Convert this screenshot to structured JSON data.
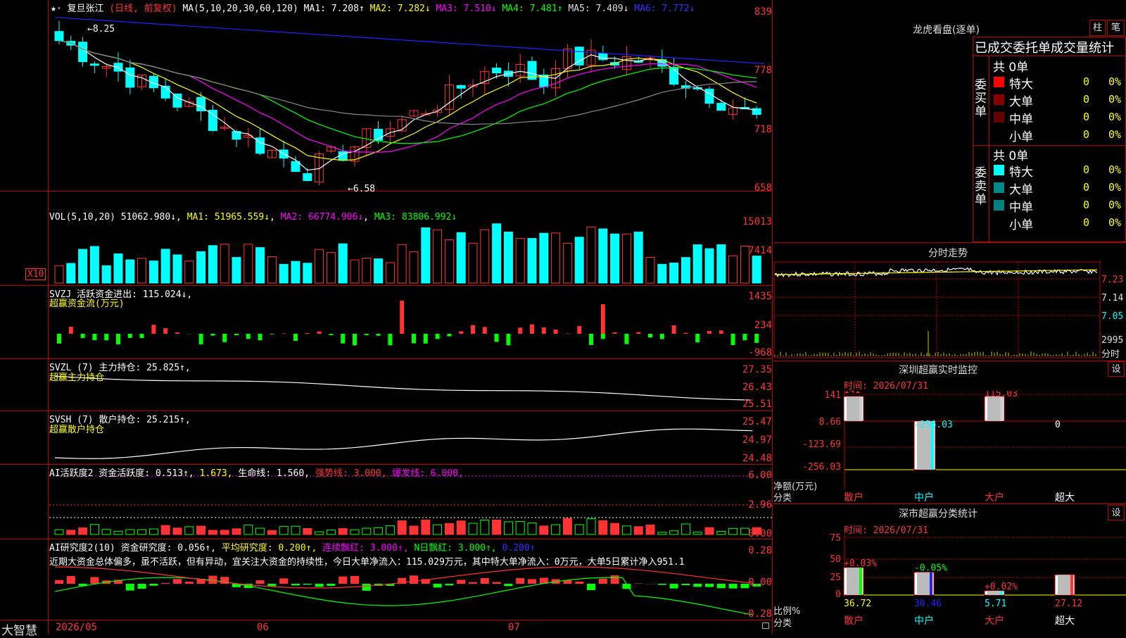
{
  "colors": {
    "up": "#ff3333",
    "down": "#00ffff",
    "ma1": "#ffffff",
    "ma2": "#ffff00",
    "ma3": "#ff00ff",
    "ma4": "#00ff00",
    "ma5": "#888888",
    "ma6": "#2222ff",
    "grid": "#aa0000",
    "axis": "#ff3333",
    "vol_up": "#ff3333",
    "green": "#00ff00",
    "yellow": "#ffff00"
  },
  "kline": {
    "stock_name": "复旦张江",
    "period": "(日线, 前复权)",
    "ma_title": "MA(5,10,20,30,60,120)",
    "ma1": "MA1: 7.208↑",
    "ma2": "MA2: 7.282↓",
    "ma3": "MA3: 7.510↓",
    "ma4": "MA4: 7.481↑",
    "ma5": "MA5: 7.409↓",
    "ma6": "MA6: 7.772↓",
    "high_mark": "8.25",
    "low_mark": "6.58",
    "y_ticks": [
      "839",
      "778",
      "718",
      "658"
    ]
  },
  "vol": {
    "title": "VOL(5,10,20)",
    "value": "51062.980↓",
    "ma1": "MA1: 51965.559↓",
    "ma2": "MA2: 66774.906↓",
    "ma3": "MA3: 83806.992↓",
    "y_ticks": [
      "15013",
      "7414"
    ],
    "unit": "X10"
  },
  "svzj": {
    "title": "SVZJ 活跃资金进出: 115.024↓,",
    "subtitle": "超赢资金流(万元)",
    "y_ticks": [
      "1435",
      "234",
      "-968"
    ]
  },
  "svzl": {
    "title": "SVZL (7) 主力持仓: 25.825↑,",
    "subtitle": "超赢主力持仓",
    "y_ticks": [
      "27.35",
      "26.43",
      "25.51"
    ]
  },
  "svsh": {
    "title": "SVSH (7) 散户持仓: 25.215↑,",
    "subtitle": "超赢散户持仓",
    "y_ticks": [
      "25.47",
      "24.97",
      "24.48"
    ]
  },
  "ai1": {
    "title": "AI活跃度2 资金活跃度: 0.513↑,",
    "v2": "1.673,",
    "life": "生命线: 1.560,",
    "strong": "强势线: 3.000,",
    "burst": "爆发线: 6.000,",
    "y_ticks": [
      "6.00",
      "2.96",
      "0.00"
    ]
  },
  "ai2": {
    "title": "AI研究度2(10) 资金研究度: 0.056↑,",
    "avg": "平均研究度: 0.200↑,",
    "red": "连续飘红: 3.000↑,",
    "nred": "N日飘红: 3.000↑,",
    "last": "0.200↑",
    "note": "近期大资金总体偏多，虽不活跃，但有异动，宜关注大资金的持续性，今日大单净流入：115.029万元，其中特大单净流入：0万元，大单5日累计净入951.1",
    "y_ticks": [
      "0.28",
      "0.00",
      "-0.28"
    ]
  },
  "bottom": {
    "brand": "大智慧",
    "dates": [
      "2026/05",
      "06",
      "07"
    ]
  },
  "dragon": {
    "title": "龙虎看盘(逐单)",
    "btn_zhu": "柱",
    "btn_bi": "笔",
    "subtitle": "已成交委托单成交量统计",
    "buy_label": "委买单",
    "sell_label": "委卖单",
    "buy_total": "共 0单",
    "sell_total": "共 0单",
    "buy_rows": [
      {
        "name": "特大",
        "count": "0",
        "pct": "0%"
      },
      {
        "name": "大单",
        "count": "0",
        "pct": "0%"
      },
      {
        "name": "中单",
        "count": "0",
        "pct": "0%"
      },
      {
        "name": "小单",
        "count": "0",
        "pct": "0%"
      }
    ],
    "sell_rows": [
      {
        "name": "特大",
        "count": "0",
        "pct": "0%"
      },
      {
        "name": "大单",
        "count": "0",
        "pct": "0%"
      },
      {
        "name": "中单",
        "count": "0",
        "pct": "0%"
      },
      {
        "name": "小单",
        "count": "0",
        "pct": "0%"
      }
    ]
  },
  "intraday": {
    "title": "分时走势",
    "y_ticks": [
      "7.23",
      "7.14",
      "7.05"
    ],
    "vol_tick": "2995",
    "vol_label": "分时"
  },
  "monitor": {
    "title": "深圳超赢实时监控",
    "btn": "设",
    "time": "时间: 2026/07/31",
    "y_ticks": [
      "141",
      "8.66",
      "-123.69",
      "-256.03"
    ],
    "bar_labels": [
      "141",
      "-256.03",
      "115.03",
      "0"
    ],
    "ylabel": "净额(万元)",
    "xlabel": "分类",
    "categories": [
      "散户",
      "中户",
      "大户",
      "超大"
    ]
  },
  "classify": {
    "title": "深市超赢分类统计",
    "btn": "设",
    "time": "时间: 2026/07/31",
    "y_ticks": [
      "75",
      "50",
      "25",
      "0"
    ],
    "top_labels": [
      "+0.03%",
      "-0.05%",
      "+0.02%"
    ],
    "values": [
      "36.72",
      "30.46",
      "5.71",
      "27.12"
    ],
    "ylabel": "比例%",
    "xlabel": "分类",
    "categories": [
      "散户",
      "中户",
      "大户",
      "超大"
    ]
  }
}
